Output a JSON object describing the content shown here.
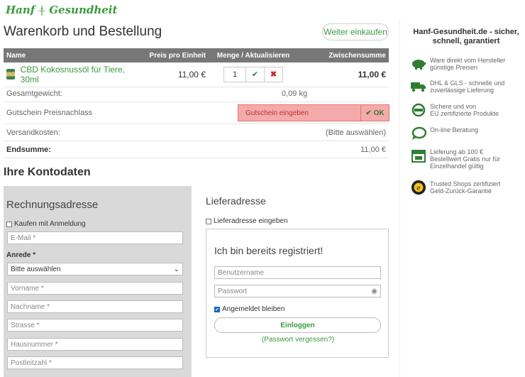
{
  "logo": {
    "text_left": "Hanf",
    "text_right": "Gesundheit"
  },
  "page": {
    "title": "Warenkorb und Bestellung",
    "continue_button": "Weiter einkaufen"
  },
  "cart": {
    "headers": {
      "name": "Name",
      "price": "Preis pro Einheit",
      "qty": "Menge / Aktualisieren",
      "subtotal": "Zwischensumme"
    },
    "items": [
      {
        "name": "CBD Kokosnussöl für Tiere, 30ml",
        "price": "11,00 €",
        "qty": "1",
        "subtotal": "11,00 €"
      }
    ]
  },
  "summary": {
    "weight_label": "Gesamtgewicht:",
    "weight_value": "0,09 kg",
    "coupon_label": "Gutschein Preisnachlass",
    "coupon_placeholder": "Gutschein eingeben",
    "coupon_ok": "OK",
    "shipping_label": "Versandkosten:",
    "shipping_value": "(Bitte auswählen)",
    "total_label": "Endsumme:",
    "total_value": "11,00 €"
  },
  "account": {
    "title": "Ihre Kontodaten",
    "billing": {
      "title": "Rechnungsadresse",
      "buy_with_login": "Kaufen mit Anmeldung",
      "email_placeholder": "E-Mail *",
      "salutation_label": "Anrede *",
      "salutation_value": "Bitte auswählen",
      "firstname_placeholder": "Vorname *",
      "lastname_placeholder": "Nachname *",
      "street_placeholder": "Strasse *",
      "housenumber_placeholder": "Hausnummer *",
      "zip_placeholder": "Postleitzahl *"
    },
    "delivery": {
      "title": "Lieferadresse",
      "enter_delivery": "Lieferadresse eingeben",
      "login_title": "Ich bin bereits registriert!",
      "username_placeholder": "Benutzername",
      "password_placeholder": "Passwort",
      "stay_logged_in": "Angemeldet bleiben",
      "login_button": "Einloggen",
      "forgot_password": "(Passwort vergessen?)"
    }
  },
  "aside": {
    "title": "Hanf-Gesundheit.de - sicher, schnell, garantiert",
    "features": [
      {
        "icon": "piggy-bank-icon",
        "line1": "Ware direkt vom Hersteller",
        "line2": "günstige Preisen"
      },
      {
        "icon": "truck-icon",
        "line1": "DHL & GLS - schnelle und",
        "line2": "zuverlässige Lieferung"
      },
      {
        "icon": "eu-certified-icon",
        "line1": "Sichere und von",
        "line2": "EU zertifizierte Produkte"
      },
      {
        "icon": "chat-icon",
        "line1": "On-line Beratung",
        "line2": ""
      },
      {
        "icon": "free-shipping-icon",
        "line1": "Lieferung ab 100 €",
        "line2": "Bestellwert Gratis nur für",
        "line3": "Einzelhandel gültig"
      },
      {
        "icon": "trusted-shops-icon",
        "line1": "Trusted Shops zertifiziert",
        "line2": "Geld-Zurück-Garantie"
      }
    ]
  },
  "colors": {
    "brand_green": "#3a9a3e",
    "header_gray": "#777777",
    "coupon_red": "#f4aaaa"
  }
}
